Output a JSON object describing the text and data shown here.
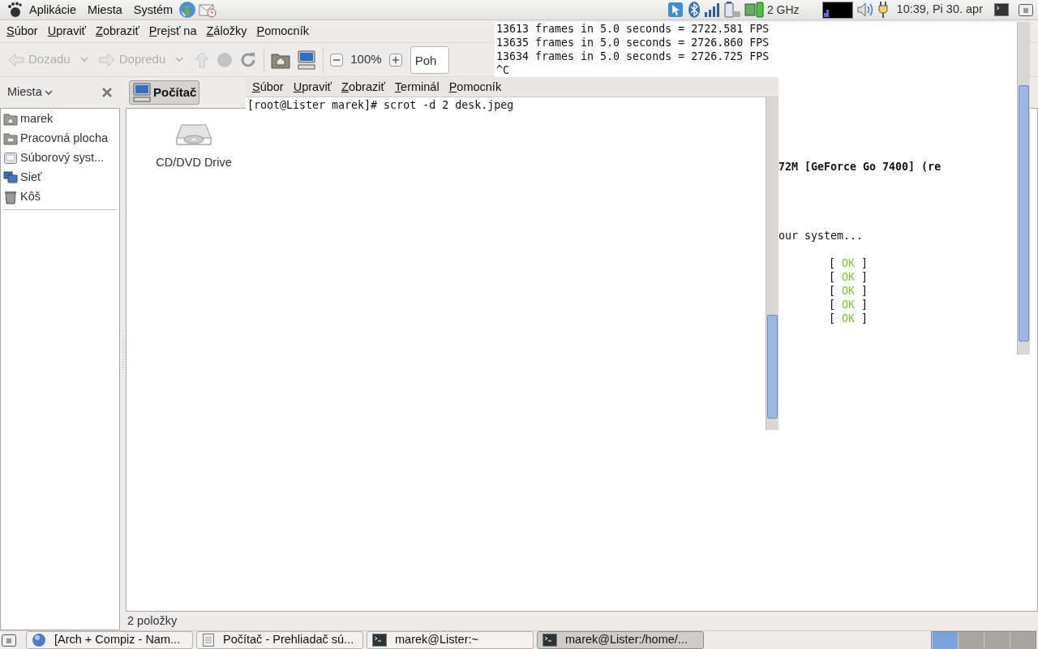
{
  "top_panel": {
    "menus": [
      "Aplikácie",
      "Miesta",
      "Systém"
    ],
    "cpu_frequency": "2 GHz",
    "clock": "10:39, Pi 30. apr"
  },
  "file_manager": {
    "menus": [
      "Súbor",
      "Upraviť",
      "Zobraziť",
      "Prejsť na",
      "Záložky",
      "Pomocník"
    ],
    "toolbar_groups": [
      {
        "items": [
          {
            "kind": "back",
            "label": "Dozadu",
            "disabled": true
          },
          {
            "kind": "forward",
            "label": "Dopredu",
            "disabled": true
          },
          {
            "kind": "up",
            "disabled": true
          },
          {
            "kind": "stop",
            "disabled": true
          },
          {
            "kind": "reload",
            "disabled": false
          }
        ]
      },
      {
        "items": [
          {
            "kind": "home",
            "disabled": false
          },
          {
            "kind": "computer",
            "disabled": false
          }
        ]
      },
      {
        "items": [
          {
            "kind": "zoom_out",
            "disabled": false
          },
          {
            "kind": "zoom_level",
            "label": "100%"
          },
          {
            "kind": "zoom_in",
            "disabled": false
          },
          {
            "kind": "view",
            "value": "Poh"
          }
        ]
      }
    ],
    "sidebar": {
      "title": "Miesta",
      "items": [
        {
          "kind": "home",
          "label": "marek"
        },
        {
          "kind": "desktop",
          "label": "Pracovná plocha"
        },
        {
          "kind": "drive",
          "label": "Súborový syst..."
        },
        {
          "kind": "network",
          "label": "Sieť"
        },
        {
          "kind": "trash",
          "label": "Kôš"
        }
      ]
    },
    "location": "Počítač",
    "items": [
      {
        "kind": "optical",
        "label": "CD/DVD Drive"
      }
    ],
    "status_bar": "2 položky"
  },
  "terminal_back": {
    "lines": [
      "13613 frames in 5.0 seconds = 2722.581 FPS",
      "13635 frames in 5.0 seconds = 2726.860 FPS",
      "13634 frames in 5.0 seconds = 2726.725 FPS",
      "^C"
    ],
    "fragments": [
      {
        "kind": "bold",
        "text": "72M [GeForce Go 7400] (re"
      },
      {
        "kind": "plain",
        "text": "our system..."
      },
      {
        "kind": "status",
        "open": "[",
        "status": "OK",
        "close": "]"
      },
      {
        "kind": "status",
        "open": "[",
        "status": "OK",
        "close": "]"
      },
      {
        "kind": "status",
        "open": "[",
        "status": "OK",
        "close": "]"
      },
      {
        "kind": "status",
        "open": "[",
        "status": "OK",
        "close": "]"
      },
      {
        "kind": "status",
        "open": "[",
        "status": "OK",
        "close": "]"
      }
    ]
  },
  "terminal_front": {
    "menus": [
      "Súbor",
      "Upraviť",
      "Zobraziť",
      "Terminál",
      "Pomocník"
    ],
    "lines": [
      "[root@Lister marek]# scrot -d 2 desk.jpeg"
    ]
  },
  "taskbar": {
    "tasks": [
      {
        "kind": "browser",
        "label": "[Arch + Compiz - Nam...",
        "selected": false
      },
      {
        "kind": "files",
        "label": "Počítač - Prehliadač sú...",
        "selected": false
      },
      {
        "kind": "terminal",
        "label": "marek@Lister:~",
        "selected": false
      },
      {
        "kind": "terminal",
        "label": "marek@Lister:/home/...",
        "selected": true
      }
    ],
    "workspaces": [
      {
        "selected": true
      },
      {
        "selected": false
      },
      {
        "selected": false
      },
      {
        "selected": false
      }
    ]
  }
}
